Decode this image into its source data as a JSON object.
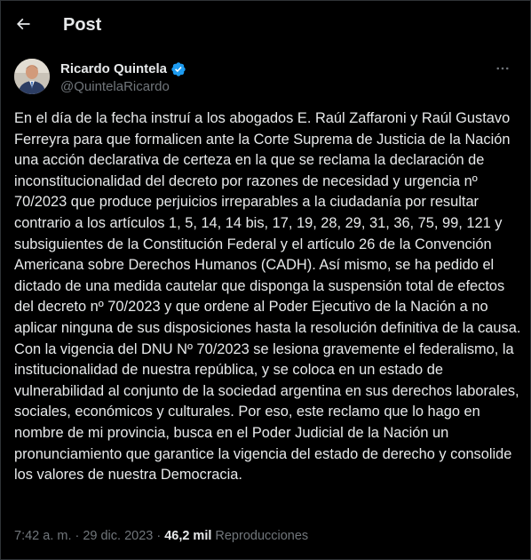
{
  "header": {
    "back_icon": "arrow-left-icon",
    "title": "Post"
  },
  "author": {
    "display_name": "Ricardo Quintela",
    "handle": "@QuintelaRicardo",
    "verified": true,
    "verified_color": "#1d9bf0",
    "more_icon": "more-horizontal-icon"
  },
  "tweet": {
    "paragraphs": [
      "En el día de la fecha instruí a los abogados E. Raúl Zaffaroni y Raúl Gustavo Ferreyra para que formalicen ante la Corte Suprema de Justicia de la Nación una acción declarativa de certeza en la que se reclama la declaración de inconstitucionalidad del decreto por razones de necesidad y urgencia nº 70/2023 que produce perjuicios irreparables a la ciudadanía por resultar contrario a los artículos 1, 5, 14, 14 bis, 17, 19, 28, 29, 31, 36, 75, 99, 121 y subsiguientes de la Constitución Federal y el artículo 26 de la Convención Americana sobre Derechos Humanos (CADH). Así mismo, se ha pedido el dictado de una medida cautelar que disponga la suspensión total de efectos del decreto nº 70/2023 y que ordene al Poder Ejecutivo de la Nación a no aplicar ninguna de sus disposiciones hasta la resolución definitiva de la causa.",
      "Con la vigencia del DNU Nº 70/2023 se lesiona gravemente el federalismo, la institucionalidad de nuestra república, y se coloca en un estado de vulnerabilidad al conjunto de la sociedad argentina en sus derechos laborales, sociales, económicos y culturales. Por eso, este reclamo que lo hago en nombre de mi provincia, busca en el Poder Judicial de la Nación un pronunciamiento que garantice la vigencia del estado de derecho y consolide los valores de nuestra Democracia."
    ]
  },
  "meta": {
    "time": "7:42 a. m.",
    "separator": "·",
    "date": "29 dic. 2023",
    "views_count": "46,2 mil",
    "views_label": "Reproducciones"
  },
  "colors": {
    "background": "#000000",
    "text_primary": "#e7e9ea",
    "text_secondary": "#71767b",
    "border": "#2f3336",
    "accent": "#1d9bf0"
  }
}
